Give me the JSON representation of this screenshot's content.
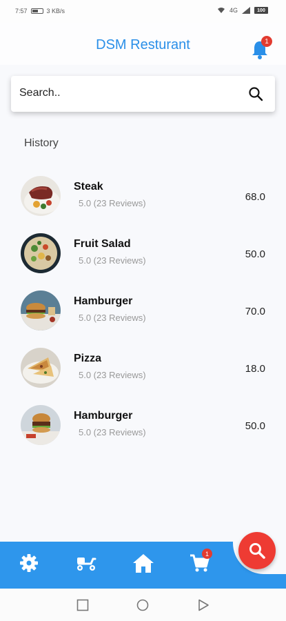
{
  "status_bar": {
    "time": "7:57",
    "speed": "3 KB/s",
    "network": "4G",
    "battery_level": "100"
  },
  "header": {
    "title": "DSM Resturant",
    "notification_count": "1"
  },
  "search": {
    "placeholder": "Search.."
  },
  "history": {
    "title": "History",
    "items": [
      {
        "name": "Steak",
        "rating": "5.0 (23 Reviews)",
        "price": "68.0",
        "image": "steak-photo"
      },
      {
        "name": "Fruit Salad",
        "rating": "5.0 (23 Reviews)",
        "price": "50.0",
        "image": "salad-photo"
      },
      {
        "name": "Hamburger",
        "rating": "5.0 (23 Reviews)",
        "price": "70.0",
        "image": "burger-photo"
      },
      {
        "name": "Pizza",
        "rating": "5.0 (23 Reviews)",
        "price": "18.0",
        "image": "pizza-photo"
      },
      {
        "name": "Hamburger",
        "rating": "5.0 (23 Reviews)",
        "price": "50.0",
        "image": "burger-photo"
      }
    ]
  },
  "bottom_nav": {
    "items": [
      "settings-icon",
      "delivery-scooter-icon",
      "home-icon",
      "cart-icon"
    ],
    "cart_count": "1",
    "fab_icon": "search-icon"
  },
  "system_nav": [
    "recent-apps-button",
    "home-button",
    "back-button"
  ],
  "colors": {
    "accent": "#2e96ec",
    "title": "#2a8fe8",
    "badge": "#e23b30",
    "fab": "#ee3b33"
  }
}
